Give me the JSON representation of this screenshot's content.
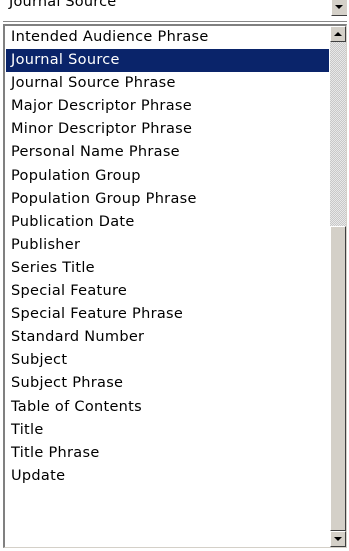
{
  "field_select": {
    "selected_value": "Journal Source"
  },
  "listbox": {
    "selected_index": 1,
    "items": [
      "Intended Audience Phrase",
      "Journal Source",
      "Journal Source Phrase",
      "Major Descriptor Phrase",
      "Minor Descriptor Phrase",
      "Personal Name Phrase",
      "Population Group",
      "Population Group Phrase",
      "Publication Date",
      "Publisher",
      "Series Title",
      "Special Feature",
      "Special Feature Phrase",
      "Standard Number",
      "Subject",
      "Subject Phrase",
      "Table of Contents",
      "Title",
      "Title Phrase",
      "Update"
    ]
  },
  "icons": {
    "dropdown_arrow": "chevron-down-icon",
    "scroll_up": "triangle-up-icon",
    "scroll_down": "triangle-down-icon"
  },
  "colors": {
    "selection_bg": "#0a246a",
    "selection_fg": "#ffffff",
    "face": "#d4d0c8"
  }
}
